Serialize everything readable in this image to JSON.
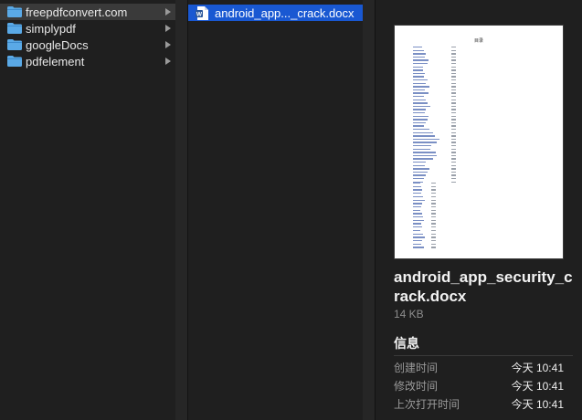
{
  "folders": [
    {
      "label": "freepdfconvert.com"
    },
    {
      "label": "simplypdf"
    },
    {
      "label": "googleDocs"
    },
    {
      "label": "pdfelement"
    }
  ],
  "file": {
    "label": "android_app..._crack.docx",
    "icon": "word-doc-icon"
  },
  "preview": {
    "toc_title": "目录",
    "name": "android_app_security_crack.docx",
    "size": "14 KB",
    "info_heading": "信息",
    "meta": [
      {
        "key": "创建时间",
        "value": "今天 10:41"
      },
      {
        "key": "修改时间",
        "value": "今天 10:41"
      },
      {
        "key": "上次打开时间",
        "value": "今天 10:41"
      }
    ]
  },
  "colors": {
    "selection": "#1958d2",
    "folder": "#5aa9e6"
  }
}
